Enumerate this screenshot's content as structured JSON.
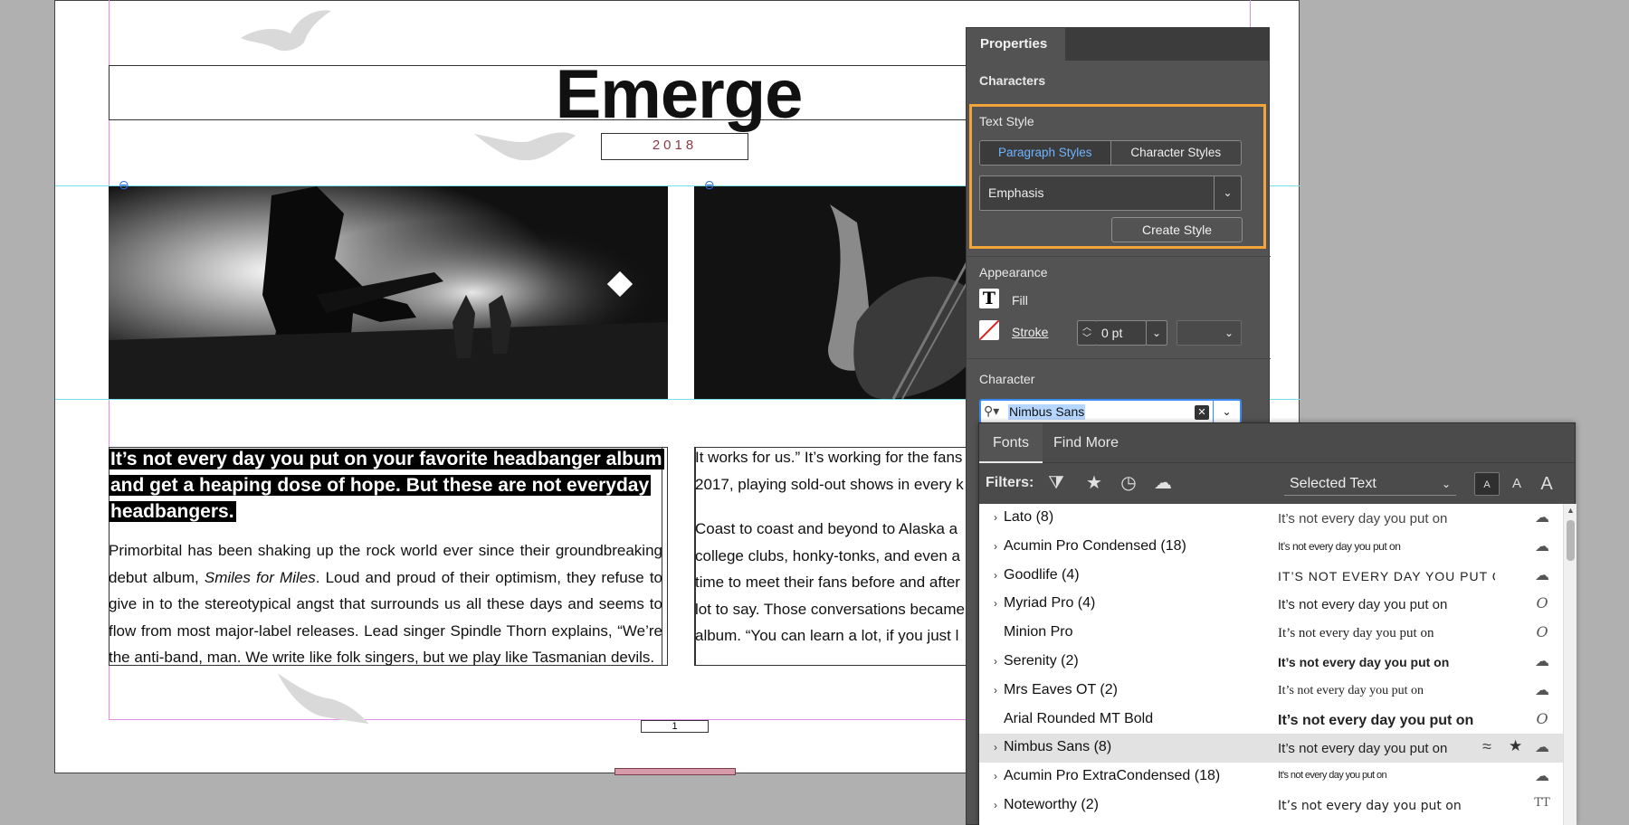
{
  "document": {
    "title": "Emerge",
    "year": "2018",
    "lead": "It’s not every day you put on your favorite headbanger album and get a heaping dose of hope. But these are not everyday headbangers.",
    "body_pre": "Primorbital has been shaking up the rock world ever since their groundbreaking debut album, ",
    "body_italic": "Smiles for Miles",
    "body_post": ". Loud and proud of their optimism, they refuse to give in to the stereotypical angst that surrounds us all these days and seems to flow from most major-label releases. Lead singer Spindle Thorn explains, “We’re the anti-band, man. We write like folk singers, but we play like Tasmanian devils.",
    "col2_lines": [
      "It works for us.” It’s working for the fans",
      "2017, playing sold-out shows in every k"
    ],
    "col2b_lines": [
      "Coast to coast and beyond to Alaska a",
      "college clubs, honky-tonks, and even a",
      "time to meet their fans before and after",
      "lot to say. Those conversations became",
      "album. “You can learn a lot, if you just l"
    ],
    "page_number": "1"
  },
  "panel": {
    "tab": "Properties",
    "characters_label": "Characters",
    "text_style_label": "Text Style",
    "paragraph_styles": "Paragraph Styles",
    "character_styles": "Character Styles",
    "style_value": "Emphasis",
    "create_style": "Create Style",
    "appearance_label": "Appearance",
    "fill_label": "Fill",
    "stroke_label": "Stroke",
    "stroke_value": "0 pt",
    "character_label": "Character",
    "font_search_value": "Nimbus Sans",
    "highlight_color": "#f2a33a"
  },
  "fonts_flyout": {
    "tabs": [
      "Fonts",
      "Find More"
    ],
    "filters_label": "Filters:",
    "preview_mode": "Selected Text",
    "size_letters": [
      "A",
      "A",
      "A"
    ],
    "fonts": [
      {
        "name": "Lato (8)",
        "expandable": true,
        "sample": "It’s not every day you put on",
        "icon": "cloud-sync-icon"
      },
      {
        "name": "Acumin Pro Condensed (18)",
        "expandable": true,
        "sample": "It’s not every day you put on",
        "icon": "cloud-sync-icon"
      },
      {
        "name": "Goodlife (4)",
        "expandable": true,
        "sample": "IT’S NOT EVERY DAY YOU PUT C",
        "icon": "cloud-sync-icon"
      },
      {
        "name": "Myriad Pro (4)",
        "expandable": true,
        "sample": "It’s not every day you put on",
        "icon": "opentype-icon"
      },
      {
        "name": "Minion Pro",
        "expandable": false,
        "sample": "It’s not every day you put on",
        "icon": "opentype-icon"
      },
      {
        "name": "Serenity (2)",
        "expandable": true,
        "sample": "It’s not every day you put on",
        "icon": "cloud-sync-icon"
      },
      {
        "name": "Mrs Eaves OT (2)",
        "expandable": true,
        "sample": "It’s not every day you put on",
        "icon": "cloud-sync-icon"
      },
      {
        "name": "Arial Rounded MT Bold",
        "expandable": false,
        "sample": "It’s not every day you put on",
        "icon": "opentype-icon"
      },
      {
        "name": "Nimbus Sans (8)",
        "expandable": true,
        "sample": "It’s not every day you put on",
        "icon": "cloud-sync-icon",
        "highlighted": true
      },
      {
        "name": "Acumin Pro ExtraCondensed (18)",
        "expandable": true,
        "sample": "It’s not every day you put on",
        "icon": "cloud-sync-icon"
      },
      {
        "name": "Noteworthy (2)",
        "expandable": true,
        "sample": "It’s not every day you put on",
        "icon": "truetype-icon"
      }
    ]
  }
}
